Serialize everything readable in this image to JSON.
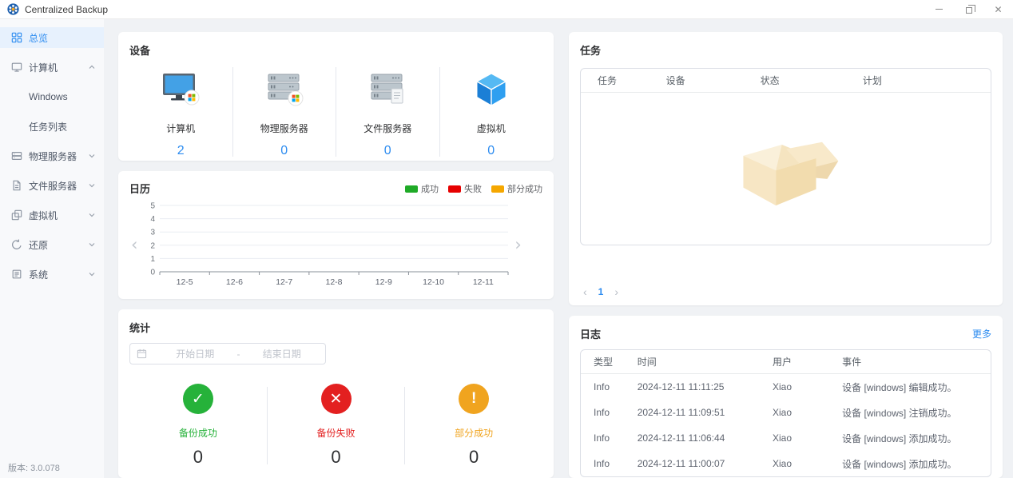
{
  "titlebar": {
    "app_title": "Centralized Backup",
    "window_controls": {
      "close_glyph": "✕"
    }
  },
  "sidebar": {
    "items": [
      {
        "id": "overview",
        "icon": "grid-icon",
        "label": "总览",
        "selected": true
      },
      {
        "id": "computer",
        "icon": "monitor-icon",
        "label": "计算机",
        "chevron": "up"
      },
      {
        "id": "windows",
        "label": "Windows",
        "child": true
      },
      {
        "id": "task-list",
        "label": "任务列表",
        "child": true
      },
      {
        "id": "physical-server",
        "icon": "server-icon",
        "label": "物理服务器",
        "chevron": "down"
      },
      {
        "id": "file-server",
        "icon": "file-server-icon",
        "label": "文件服务器",
        "chevron": "down"
      },
      {
        "id": "virtual-machine",
        "icon": "vm-icon",
        "label": "虚拟机",
        "chevron": "down"
      },
      {
        "id": "restore",
        "icon": "restore-icon",
        "label": "还原",
        "chevron": "down"
      },
      {
        "id": "system",
        "icon": "system-icon",
        "label": "系统",
        "chevron": "down"
      }
    ],
    "version": "版本: 3.0.078"
  },
  "devices": {
    "title": "设备",
    "items": [
      {
        "icon": "computer-icon",
        "name": "计算机",
        "count": "2"
      },
      {
        "icon": "physical-server-icon",
        "name": "物理服务器",
        "count": "0"
      },
      {
        "icon": "file-server-device-icon",
        "name": "文件服务器",
        "count": "0"
      },
      {
        "icon": "virtual-machine-icon",
        "name": "虚拟机",
        "count": "0"
      }
    ]
  },
  "calendar": {
    "title": "日历",
    "prev": "‹",
    "next": "›"
  },
  "chart_data": {
    "type": "bar",
    "title": "日历",
    "categories": [
      "12-5",
      "12-6",
      "12-7",
      "12-8",
      "12-9",
      "12-10",
      "12-11"
    ],
    "series": [
      {
        "name": "成功",
        "color": "#1faa27",
        "values": [
          0,
          0,
          0,
          0,
          0,
          0,
          0
        ]
      },
      {
        "name": "失败",
        "color": "#e60000",
        "values": [
          0,
          0,
          0,
          0,
          0,
          0,
          0
        ]
      },
      {
        "name": "部分成功",
        "color": "#f5a700",
        "values": [
          0,
          0,
          0,
          0,
          0,
          0,
          0
        ]
      }
    ],
    "ylim": [
      0,
      5
    ],
    "yticks": [
      0,
      1,
      2,
      3,
      4,
      5
    ],
    "grid": true,
    "legend_position": "top-right"
  },
  "tasks": {
    "title": "任务",
    "columns": [
      "任务",
      "设备",
      "状态",
      "计划"
    ],
    "rows": [],
    "pagination": {
      "prev": "‹",
      "page": "1",
      "next": "›"
    }
  },
  "stats": {
    "title": "统计",
    "date_range": {
      "start_placeholder": "开始日期",
      "separator": "-",
      "end_placeholder": "结束日期"
    },
    "items": [
      {
        "status": "success",
        "glyph": "✓",
        "label": "备份成功",
        "value": "0",
        "color": "#26b23a"
      },
      {
        "status": "fail",
        "glyph": "✕",
        "label": "备份失败",
        "value": "0",
        "color": "#e32020"
      },
      {
        "status": "partial",
        "glyph": "!",
        "label": "部分成功",
        "value": "0",
        "color": "#f0a41f"
      }
    ]
  },
  "logs": {
    "title": "日志",
    "more_label": "更多",
    "columns": [
      "类型",
      "时间",
      "用户",
      "事件"
    ],
    "rows": [
      [
        "Info",
        "2024-12-11 11:11:25",
        "Xiao",
        "设备 [windows] 编辑成功。"
      ],
      [
        "Info",
        "2024-12-11 11:09:51",
        "Xiao",
        "设备 [windows] 注销成功。"
      ],
      [
        "Info",
        "2024-12-11 11:06:44",
        "Xiao",
        "设备 [windows] 添加成功。"
      ],
      [
        "Info",
        "2024-12-11 11:00:07",
        "Xiao",
        "设备 [windows] 添加成功。"
      ]
    ]
  },
  "colors": {
    "accent": "#2d8cf0",
    "success": "#26b23a",
    "fail": "#e32020",
    "partial": "#f0a41f"
  }
}
